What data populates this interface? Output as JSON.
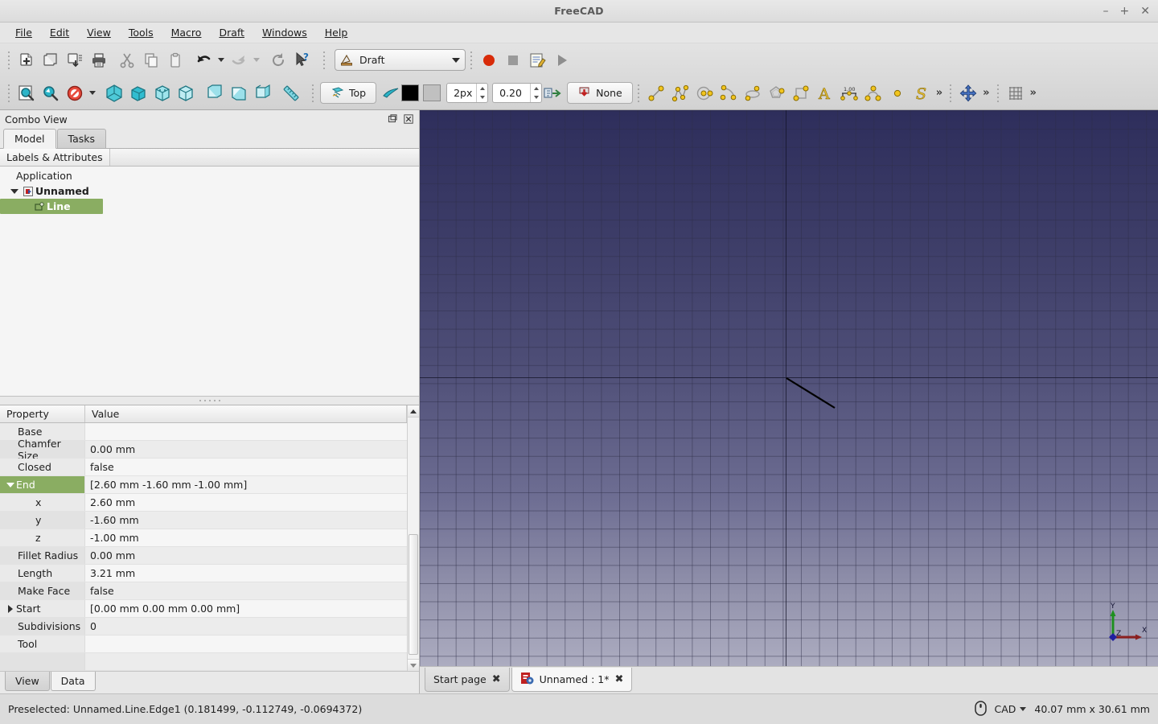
{
  "window": {
    "title": "FreeCAD",
    "minimize": "–",
    "maximize": "+",
    "close": "✕"
  },
  "menubar": {
    "items": [
      {
        "label": "File"
      },
      {
        "label": "Edit"
      },
      {
        "label": "View"
      },
      {
        "label": "Tools"
      },
      {
        "label": "Macro"
      },
      {
        "label": "Draft"
      },
      {
        "label": "Windows"
      },
      {
        "label": "Help"
      }
    ]
  },
  "toolbar_file": {
    "buttons": [
      {
        "name": "new-document-button",
        "tip": "New"
      },
      {
        "name": "open-document-button",
        "tip": "Open"
      },
      {
        "name": "save-document-button",
        "tip": "Save"
      },
      {
        "name": "print-button",
        "tip": "Print"
      },
      {
        "name": "cut-button",
        "tip": "Cut"
      },
      {
        "name": "copy-button",
        "tip": "Copy"
      },
      {
        "name": "paste-button",
        "tip": "Paste"
      },
      {
        "name": "undo-button",
        "tip": "Undo"
      },
      {
        "name": "redo-button",
        "tip": "Redo"
      },
      {
        "name": "refresh-button",
        "tip": "Refresh"
      },
      {
        "name": "whats-this-button",
        "tip": "What's This"
      }
    ]
  },
  "workbench": {
    "label": "Draft"
  },
  "macro_toolbar": {
    "record_label": "Macro recording",
    "stop_label": "Stop macro recording",
    "edit_label": "Macros",
    "execute_label": "Execute macro"
  },
  "toolbar_view": {
    "buttons": [
      {
        "name": "fit-all-button"
      },
      {
        "name": "fit-selection-button"
      },
      {
        "name": "draw-style-button"
      },
      {
        "name": "isometric-view-button"
      },
      {
        "name": "front-view-button"
      },
      {
        "name": "top-view-button"
      },
      {
        "name": "right-view-button"
      },
      {
        "name": "rear-view-button"
      },
      {
        "name": "bottom-view-button"
      },
      {
        "name": "left-view-button"
      },
      {
        "name": "measure-button"
      }
    ]
  },
  "draft_snap": {
    "working_plane_label": "Top",
    "line_width_value": "2px",
    "transparency_value": "0.20",
    "autogroup_label": "None",
    "line_color": "#000000",
    "face_color": "#c0c0c0"
  },
  "draft_tools": {
    "buttons": [
      {
        "name": "draft-line-tool"
      },
      {
        "name": "draft-polyline-tool"
      },
      {
        "name": "draft-circle-tool"
      },
      {
        "name": "draft-arc-tool"
      },
      {
        "name": "draft-ellipse-tool"
      },
      {
        "name": "draft-polygon-tool"
      },
      {
        "name": "draft-rectangle-tool"
      },
      {
        "name": "draft-text-tool"
      },
      {
        "name": "draft-dimension-tool"
      },
      {
        "name": "draft-bspline-tool"
      },
      {
        "name": "draft-point-tool"
      },
      {
        "name": "draft-shapestring-tool"
      }
    ],
    "overflow": "»"
  },
  "draft_mod": {
    "move_label": "Move",
    "overflow": "»"
  },
  "draft_grid": {
    "grid_label": "Toggle grid",
    "overflow": "»"
  },
  "combo_view": {
    "title": "Combo View",
    "float_icon": "float-icon",
    "close_icon": "close-icon",
    "tabs": [
      {
        "label": "Model",
        "active": true
      },
      {
        "label": "Tasks",
        "active": false
      }
    ],
    "tree_header": "Labels & Attributes",
    "tree": [
      {
        "label": "Application",
        "level": 0,
        "twisty": "none",
        "icon": "none",
        "selected": false,
        "bold": false
      },
      {
        "label": "Unnamed",
        "level": 1,
        "twisty": "down",
        "icon": "document-icon",
        "selected": false,
        "bold": true
      },
      {
        "label": "Line",
        "level": 2,
        "twisty": "none",
        "icon": "draft-line-icon",
        "selected": true,
        "bold": true
      }
    ]
  },
  "property_editor": {
    "headers": {
      "property": "Property",
      "value": "Value"
    },
    "rows": [
      {
        "name": "Base",
        "value": "",
        "indent": 1,
        "twisty": "none",
        "selected": false
      },
      {
        "name": "Chamfer Size",
        "value": "0.00 mm",
        "indent": 1,
        "twisty": "none",
        "selected": false
      },
      {
        "name": "Closed",
        "value": "false",
        "indent": 1,
        "twisty": "none",
        "selected": false
      },
      {
        "name": "End",
        "value": "[2.60 mm  -1.60 mm  -1.00 mm]",
        "indent": 1,
        "twisty": "down",
        "selected": true
      },
      {
        "name": "x",
        "value": "2.60 mm",
        "indent": 2,
        "twisty": "none",
        "selected": false
      },
      {
        "name": "y",
        "value": "-1.60 mm",
        "indent": 2,
        "twisty": "none",
        "selected": false
      },
      {
        "name": "z",
        "value": "-1.00 mm",
        "indent": 2,
        "twisty": "none",
        "selected": false
      },
      {
        "name": "Fillet Radius",
        "value": "0.00 mm",
        "indent": 1,
        "twisty": "none",
        "selected": false
      },
      {
        "name": "Length",
        "value": "3.21 mm",
        "indent": 1,
        "twisty": "none",
        "selected": false
      },
      {
        "name": "Make Face",
        "value": "false",
        "indent": 1,
        "twisty": "none",
        "selected": false
      },
      {
        "name": "Start",
        "value": "[0.00 mm  0.00 mm  0.00 mm]",
        "indent": 1,
        "twisty": "right",
        "selected": false
      },
      {
        "name": "Subdivisions",
        "value": "0",
        "indent": 1,
        "twisty": "none",
        "selected": false
      },
      {
        "name": "Tool",
        "value": "",
        "indent": 1,
        "twisty": "none",
        "selected": false
      }
    ],
    "bottom_tabs": [
      {
        "label": "View",
        "active": false
      },
      {
        "label": "Data",
        "active": true
      }
    ]
  },
  "viewport": {
    "document_tabs": [
      {
        "label": "Start page",
        "active": false,
        "icon": "none",
        "close": "✖"
      },
      {
        "label": "Unnamed : 1*",
        "active": true,
        "icon": "freecad-icon",
        "close": "✖"
      }
    ],
    "axis_gizmo": {
      "x": "X",
      "y": "Y",
      "z": "Z",
      "x_color": "#8b2020",
      "y_color": "#1f9020",
      "z_color": "#2020a0"
    },
    "background_top": "#2e2e5c",
    "background_bottom": "#acacc0",
    "line_color": "#000000"
  },
  "statusbar": {
    "message": "Preselected: Unnamed.Line.Edge1 (0.181499, -0.112749, -0.0694372)",
    "navigation_style": "CAD",
    "dimensions": "40.07 mm x 30.61 mm",
    "mouse_icon": "mouse-icon"
  }
}
